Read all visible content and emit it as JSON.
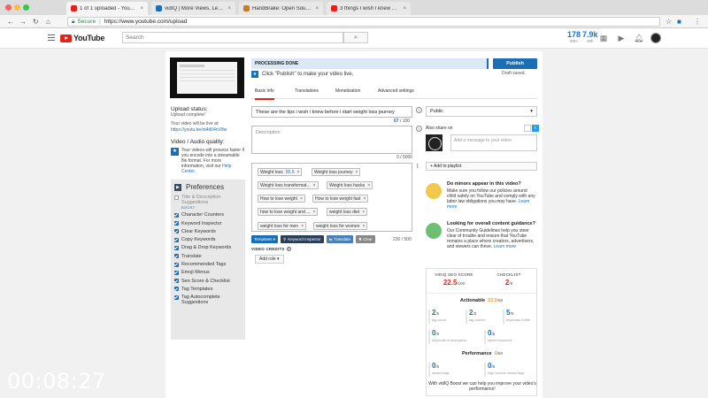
{
  "browser": {
    "tabs": [
      {
        "label": "1 of 1 uploaded - YouTube",
        "fav_color": "#e62117"
      },
      {
        "label": "vidIQ | More Views, Less Time.",
        "fav_color": "#1a6fb4"
      },
      {
        "label": "HandBrake: Open Source Video",
        "fav_color": "#c77c2a"
      },
      {
        "label": "3 things I wish I knew before I...",
        "fav_color": "#e62117"
      }
    ],
    "secure_label": "Secure",
    "url": "https://www.youtube.com/upload"
  },
  "header": {
    "logo_text": "YouTube",
    "search_placeholder": "Search",
    "stat1": {
      "value": "178",
      "unit": "60m"
    },
    "stat2": {
      "value": "7.9k",
      "unit": "48h"
    }
  },
  "left": {
    "upload_status_title": "Upload status:",
    "upload_status_text": "Upload complete!",
    "live_at_text": "Your video will be live at:",
    "live_link": "https://youtu.be/ot4d04nV8w",
    "video_quality_title": "Video / Audio quality:",
    "quality_text": "Your videos will process faster if you encode into a streamable file format. For more information, visit our",
    "help_center": "Help Center."
  },
  "preferences": {
    "title": "Preferences",
    "boost_label": "BOOST",
    "items": [
      {
        "label": "Title & Description Suggestions",
        "checked": false,
        "dim": true
      },
      {
        "label": "Character Counters",
        "checked": true
      },
      {
        "label": "Keyword Inspector",
        "checked": true
      },
      {
        "label": "Clear Keywords",
        "checked": true
      },
      {
        "label": "Copy Keywords",
        "checked": true
      },
      {
        "label": "Drag & Drop Keywords",
        "checked": true
      },
      {
        "label": "Translate",
        "checked": true
      },
      {
        "label": "Recommended Tags",
        "checked": true
      },
      {
        "label": "Emoji Menus",
        "checked": true
      },
      {
        "label": "Seo Score & Checklist",
        "checked": true
      },
      {
        "label": "Tag Templates",
        "checked": true
      },
      {
        "label": "Tag Autocomplete Suggestions",
        "checked": true
      }
    ]
  },
  "form": {
    "status": "PROCESSING DONE",
    "publish_label": "Publish",
    "draft_saved": "Draft saved.",
    "hint": "Click \"Publish\" to make your video live.",
    "subtabs": [
      "Basic info",
      "Translations",
      "Monetization",
      "Advanced settings"
    ],
    "title_value": "These are the tips i wish i knew before i start weight loss journey",
    "title_count": "67",
    "title_max": " / 100",
    "description_placeholder": "Description",
    "description_count": "0 / 5000",
    "tags": [
      {
        "text": "Weight loss",
        "num": "55.5"
      },
      {
        "text": "Weight loss journey",
        "num": ""
      },
      {
        "text": "Weight loss transformat...",
        "num": ""
      },
      {
        "text": "Weight loss hacks",
        "num": ""
      },
      {
        "text": "How to lose weight",
        "num": ""
      },
      {
        "text": "How to lose weight fast",
        "num": ""
      },
      {
        "text": "how to lose weight and ...",
        "num": ""
      },
      {
        "text": "weight loss diet",
        "num": ""
      },
      {
        "text": "weight loss for men",
        "num": ""
      },
      {
        "text": "weight loss for women",
        "num": ""
      }
    ],
    "tag_remove": "×",
    "tools": {
      "templates": "Templates ▾",
      "keyword_inspector": "Keyword Inspector",
      "translate": "Translate",
      "clear": "✖ Clear"
    },
    "tags_count": "230 / 500",
    "credits_label": "VIDEO CREDITS",
    "add_role": "Add role ▾"
  },
  "right": {
    "privacy": "Public",
    "share_label": "Also share on",
    "share_placeholder": "Add a message to your video",
    "playlist": "+ Add to playlist",
    "minors_title": "Do minors appear in this video?",
    "minors_text": "Make sure you follow our policies around child safety on YouTube and comply with any labor law obligations you may have.",
    "minors_link": "Learn more",
    "guidance_title": "Looking for overall content guidance?",
    "guidance_text": "Our Community Guidelines help you steer clear of trouble and ensure that YouTube remains a place where creators, advertisers, and viewers can thrive.",
    "guidance_link": "Learn more"
  },
  "seo": {
    "score_label": "VIDIQ SEO SCORE",
    "score": "22.5",
    "score_max": "/100",
    "checklist_label": "CHECKLIST",
    "checklist": "2",
    "checklist_max": "/8",
    "actionable_label": "Actionable",
    "actionable_score": "22.5",
    "actionable_max": "/50",
    "metrics": [
      {
        "value": "2",
        "max": "/5",
        "label": "tag count"
      },
      {
        "value": "2",
        "max": "/5",
        "label": "tag volume"
      },
      {
        "value": "5",
        "max": "/5",
        "label": "keywords in title"
      },
      {
        "value": "0",
        "max": "/5",
        "label": "keywords in description"
      },
      {
        "value": "0",
        "max": "/5",
        "label": "tripled keywords"
      }
    ],
    "performance_label": "Performance",
    "performance_score": "0",
    "performance_max": "/50",
    "perf_metrics": [
      {
        "value": "0",
        "max": "/5",
        "label": "ranked tags"
      },
      {
        "value": "0",
        "max": "/5",
        "label": "high volume ranked tags"
      }
    ],
    "footer": "With vidIQ Boost we can help you improve your video's performance!"
  },
  "overlay": {
    "timer": "00:08:27"
  }
}
